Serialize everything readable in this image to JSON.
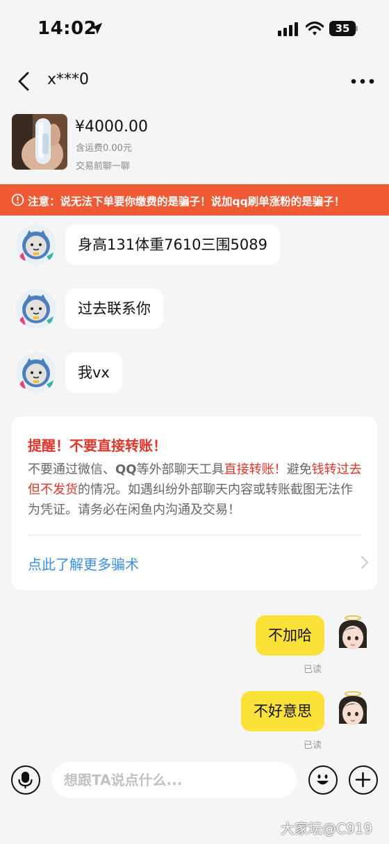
{
  "status_bar": {
    "time": "14:02",
    "battery": "35"
  },
  "nav": {
    "title": "x***0"
  },
  "product": {
    "price": "¥4000.00",
    "shipping": "含运费0.00元",
    "pre_chat": "交易前聊一聊"
  },
  "banner": {
    "text": "注意：说无法下单要你缴费的是骗子！说加qq刷单涨粉的是骗子！"
  },
  "messages": {
    "incoming": [
      "身高131体重7610三围5089",
      "过去联系你",
      "我vx"
    ],
    "outgoing": [
      "不加哈",
      "不好意思"
    ],
    "read_status": "已读"
  },
  "reminder": {
    "title": "提醒！不要直接转账！",
    "body": {
      "p1": "不要通过微信、",
      "p2": "QQ",
      "p3": "等外部聊天工具",
      "p4": "直接转账！",
      "p5": "避免",
      "p6": "钱转过去但不发货",
      "p7": "的情况。如遇纠纷外部聊天内容或转账截图无法作为凭证。请务必在闲鱼内沟通及交易！"
    },
    "link": "点此了解更多骗术"
  },
  "input": {
    "placeholder": "想跟TA说点什么..."
  },
  "watermark": "大家坛@C919",
  "colors": {
    "banner": "#ef5a35",
    "outgoing_bubble": "#fbe138",
    "warning_text": "#e0352b",
    "link": "#3a8ee6"
  }
}
